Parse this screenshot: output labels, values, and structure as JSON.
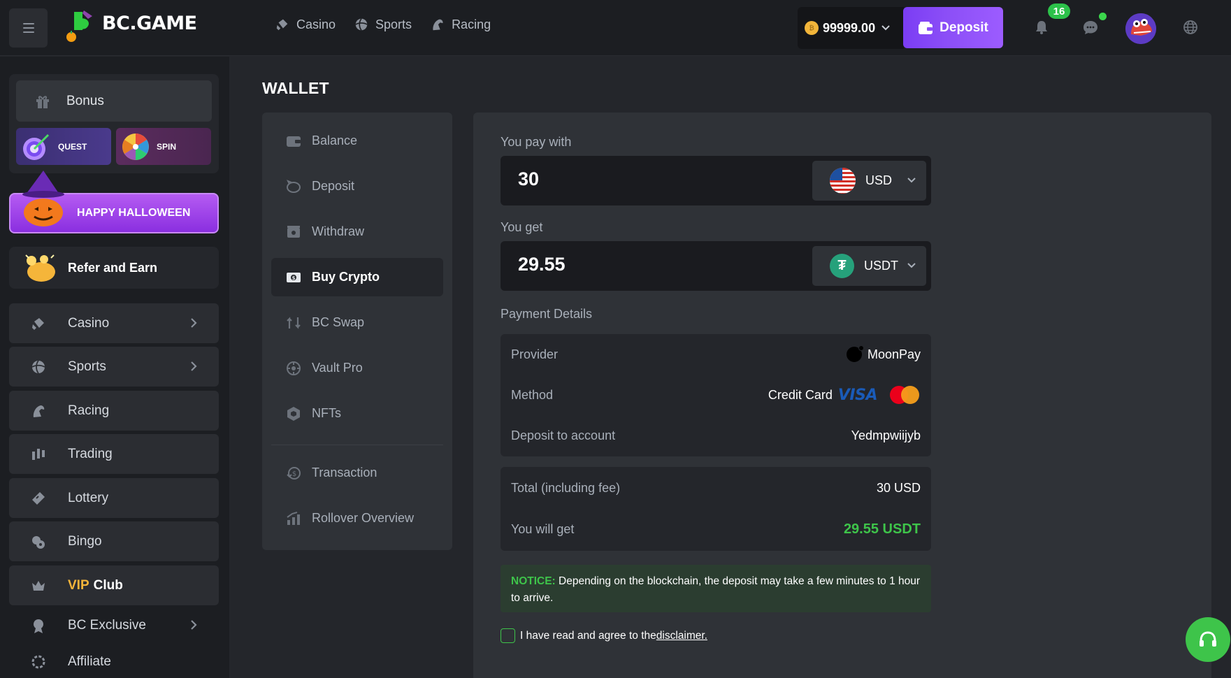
{
  "header": {
    "logo_text": "BC.GAME",
    "nav": [
      {
        "label": "Casino",
        "icon": "casino-icon"
      },
      {
        "label": "Sports",
        "icon": "sports-icon"
      },
      {
        "label": "Racing",
        "icon": "racing-icon"
      }
    ],
    "balance": "99999.00",
    "deposit_label": "Deposit",
    "notification_count": "16"
  },
  "sidebar": {
    "bonus": "Bonus",
    "quest": "QUEST",
    "spin": "SPIN",
    "halloween": "HAPPY HALLOWEEN",
    "refer": "Refer and Earn",
    "items": [
      {
        "label": "Casino",
        "icon": "casino-icon",
        "has_arrow": true
      },
      {
        "label": "Sports",
        "icon": "sports-icon",
        "has_arrow": true
      },
      {
        "label": "Racing",
        "icon": "racing-icon",
        "has_arrow": false
      },
      {
        "label": "Trading",
        "icon": "trading-icon",
        "has_arrow": false
      },
      {
        "label": "Lottery",
        "icon": "lottery-icon",
        "has_arrow": false
      },
      {
        "label": "Bingo",
        "icon": "bingo-icon",
        "has_arrow": false
      },
      {
        "label": "Club",
        "prefix": "VIP",
        "icon": "crown-icon",
        "has_arrow": false
      },
      {
        "label": "BC Exclusive",
        "icon": "exclusive-icon",
        "has_arrow": true
      },
      {
        "label": "Affiliate",
        "icon": "affiliate-icon",
        "has_arrow": false
      }
    ]
  },
  "wallet": {
    "title": "WALLET",
    "menu": [
      {
        "label": "Balance",
        "icon": "wallet-icon"
      },
      {
        "label": "Deposit",
        "icon": "piggy-bank-icon"
      },
      {
        "label": "Withdraw",
        "icon": "withdraw-icon"
      },
      {
        "label": "Buy Crypto",
        "icon": "buy-crypto-icon",
        "active": true
      },
      {
        "label": "BC Swap",
        "icon": "swap-icon"
      },
      {
        "label": "Vault Pro",
        "icon": "vault-icon"
      },
      {
        "label": "NFTs",
        "icon": "nft-icon"
      },
      {
        "label": "Transaction",
        "icon": "transaction-icon"
      },
      {
        "label": "Rollover Overview",
        "icon": "rollover-icon"
      }
    ]
  },
  "buy": {
    "pay_label": "You pay with",
    "pay_value": "30",
    "pay_currency": "USD",
    "get_label": "You get",
    "get_value": "29.55",
    "get_currency": "USDT",
    "details_label": "Payment Details",
    "provider_label": "Provider",
    "provider_value": "MoonPay",
    "method_label": "Method",
    "method_value": "Credit Card",
    "visa_text": "VISA",
    "account_label": "Deposit to account",
    "account_value": "Yedmpwiijyb",
    "total_label": "Total (including fee)",
    "total_value": "30 USD",
    "will_get_label": "You will get",
    "will_get_value": "29.55 USDT",
    "notice_title": "NOTICE:",
    "notice_text": " Depending on the blockchain, the deposit may take a few minutes to 1 hour to arrive.",
    "agree_text": "I have read and agree to the",
    "disclaimer_link": " disclaimer."
  },
  "colors": {
    "accent_purple": "#8c4ff7",
    "success_green": "#3ec44a",
    "vip_gold": "#f5b53a"
  }
}
